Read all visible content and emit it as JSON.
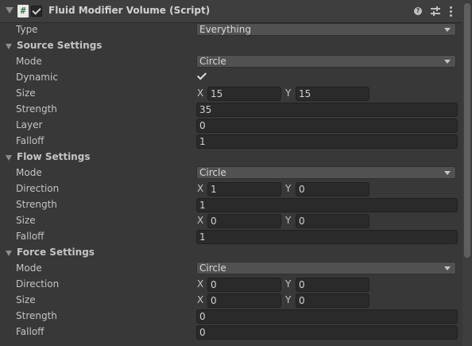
{
  "header": {
    "title": "Fluid Modifier Volume (Script)",
    "enabled": true,
    "help_icon": "help-icon",
    "presets_icon": "presets-icon",
    "menu_icon": "kebab-menu-icon"
  },
  "type_row": {
    "label": "Type",
    "value": "Everything"
  },
  "source": {
    "title": "Source Settings",
    "mode": {
      "label": "Mode",
      "value": "Circle"
    },
    "dynamic": {
      "label": "Dynamic",
      "checked": true
    },
    "size": {
      "label": "Size",
      "x_label": "X",
      "x": "15",
      "y_label": "Y",
      "y": "15"
    },
    "strength": {
      "label": "Strength",
      "value": "35"
    },
    "layer": {
      "label": "Layer",
      "value": "0"
    },
    "falloff": {
      "label": "Falloff",
      "value": "1"
    }
  },
  "flow": {
    "title": "Flow Settings",
    "mode": {
      "label": "Mode",
      "value": "Circle"
    },
    "direction": {
      "label": "Direction",
      "x_label": "X",
      "x": "1",
      "y_label": "Y",
      "y": "0"
    },
    "strength": {
      "label": "Strength",
      "value": "1"
    },
    "size": {
      "label": "Size",
      "x_label": "X",
      "x": "0",
      "y_label": "Y",
      "y": "0"
    },
    "falloff": {
      "label": "Falloff",
      "value": "1"
    }
  },
  "force": {
    "title": "Force Settings",
    "mode": {
      "label": "Mode",
      "value": "Circle"
    },
    "direction": {
      "label": "Direction",
      "x_label": "X",
      "x": "0",
      "y_label": "Y",
      "y": "0"
    },
    "size": {
      "label": "Size",
      "x_label": "X",
      "x": "0",
      "y_label": "Y",
      "y": "0"
    },
    "strength": {
      "label": "Strength",
      "value": "0"
    },
    "falloff": {
      "label": "Falloff",
      "value": "0"
    }
  }
}
